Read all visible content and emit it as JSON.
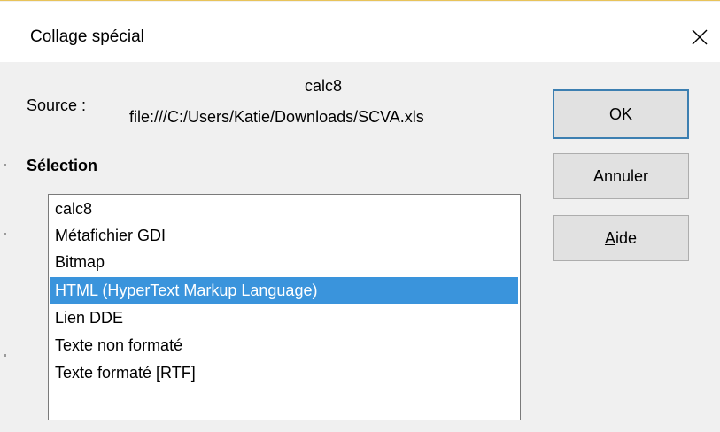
{
  "dialog": {
    "title": "Collage spécial",
    "close_icon": "close-icon"
  },
  "source": {
    "label": "Source :",
    "name": "calc8",
    "path": "file:///C:/Users/Katie/Downloads/SCVA.xls"
  },
  "selection": {
    "heading": "Sélection",
    "items": [
      {
        "label": "calc8",
        "selected": false
      },
      {
        "label": "Métafichier GDI",
        "selected": false
      },
      {
        "label": "Bitmap",
        "selected": false
      },
      {
        "label": "HTML (HyperText Markup Language)",
        "selected": true
      },
      {
        "label": "Lien DDE",
        "selected": false
      },
      {
        "label": "Texte non formaté",
        "selected": false
      },
      {
        "label": "Texte formaté [RTF]",
        "selected": false
      }
    ]
  },
  "buttons": {
    "ok": "OK",
    "cancel": "Annuler",
    "help_accel": "A",
    "help_rest": "ide"
  },
  "colors": {
    "selection_bg": "#3a94dc",
    "default_button_border": "#3c7fb1",
    "dialog_bg": "#f0f0f0"
  }
}
